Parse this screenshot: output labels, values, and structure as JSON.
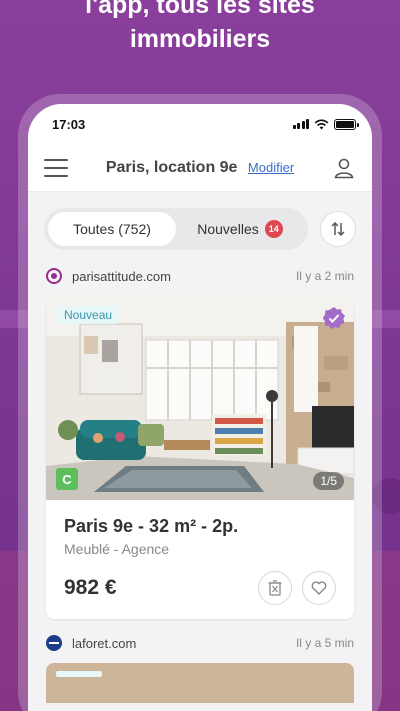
{
  "hero": {
    "line1": "l'app, tous les sites",
    "line2": "immobiliers"
  },
  "status_bar": {
    "time": "17:03"
  },
  "header": {
    "title": "Paris, location 9e",
    "edit_label": "Modifier"
  },
  "filters": {
    "all_label": "Toutes (752)",
    "new_label": "Nouvelles",
    "new_count": "14"
  },
  "listings": [
    {
      "source": "parisattitude.com",
      "time": "Il y a 2 min",
      "badge": "Nouveau",
      "energy_class": "C",
      "photo_counter": "1/5",
      "title": "Paris 9e - 32 m² - 2p.",
      "subtitle": "Meublé - Agence",
      "price": "982 €"
    },
    {
      "source": "laforet.com",
      "time": "Il y a 5 min"
    }
  ],
  "colors": {
    "background": "#8a3f9c",
    "accent_link": "#3a6fc8",
    "badge_red": "#e04850",
    "energy_green": "#5cbf5c",
    "verified_purple": "#a36cc9"
  }
}
